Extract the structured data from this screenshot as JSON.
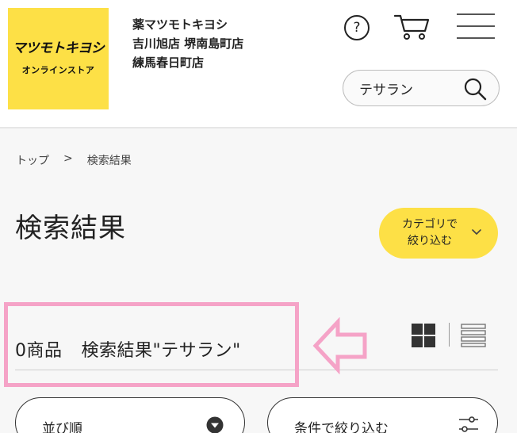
{
  "header": {
    "logo_main": "マツモトキヨシ",
    "logo_sub": "オンラインストア",
    "store_names": [
      "薬マツモトキヨシ",
      "吉川旭店 堺南島町店",
      "練馬春日町店"
    ],
    "help_glyph": "?",
    "search": {
      "value": "テサラン",
      "placeholder": ""
    }
  },
  "breadcrumb": {
    "home": "トップ",
    "separator": ">",
    "current": "検索結果"
  },
  "page_title": "検索結果",
  "category_button": {
    "label": "カテゴリで\n絞り込む"
  },
  "results": {
    "count_label": "0商品",
    "query_label": "検索結果\"テサラン\""
  },
  "controls": {
    "sort_label": "並び順",
    "filter_label": "条件で絞り込む"
  },
  "icons": {
    "help": "question-circle-icon",
    "cart": "shopping-cart-icon",
    "menu": "hamburger-menu-icon",
    "search": "search-icon",
    "category_chevron": "chevron-down-icon",
    "grid_view": "grid-view-icon",
    "list_view": "list-view-icon",
    "sort_dropdown": "dropdown-circle-icon",
    "filter": "filter-sliders-icon",
    "annotation_arrow": "left-arrow-annotation-icon"
  },
  "colors": {
    "brand_yellow": "#fde046",
    "annotation_pink": "#f5a3c7",
    "text": "#222222",
    "background": "#f7f7f7"
  }
}
